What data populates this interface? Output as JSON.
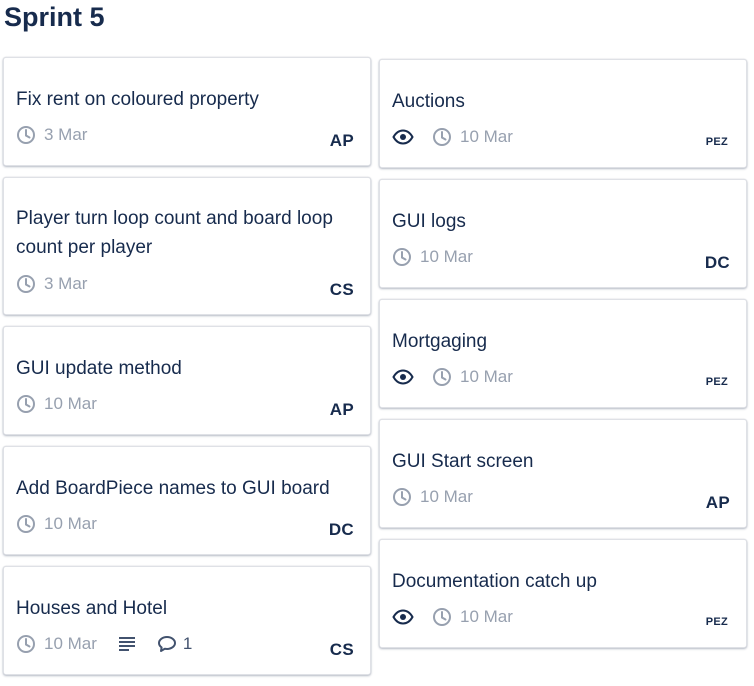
{
  "list": {
    "title": "Sprint 5"
  },
  "cards": {
    "left": [
      {
        "title": "Fix rent on coloured property",
        "due": "3 Mar",
        "member": "AP"
      },
      {
        "title": "Player turn loop count and board loop count per player",
        "due": "3 Mar",
        "member": "CS"
      },
      {
        "title": "GUI update method",
        "due": "10 Mar",
        "member": "AP"
      },
      {
        "title": "Add BoardPiece names to GUI board",
        "due": "10 Mar",
        "member": "DC"
      },
      {
        "title": "Houses and Hotel",
        "due": "10 Mar",
        "comments": "1",
        "member": "CS"
      }
    ],
    "right": [
      {
        "title": "Auctions",
        "due": "10 Mar",
        "member": "PEZ"
      },
      {
        "title": "GUI logs",
        "due": "10 Mar",
        "member": "DC"
      },
      {
        "title": "Mortgaging",
        "due": "10 Mar",
        "member": "PEZ"
      },
      {
        "title": "GUI Start screen",
        "due": "10 Mar",
        "member": "AP"
      },
      {
        "title": "Documentation catch up",
        "due": "10 Mar",
        "member": "PEZ"
      }
    ]
  },
  "icons": {
    "due": "clock-icon",
    "watch": "eye-icon",
    "description": "description-lines-icon",
    "comments": "comment-bubble-icon"
  }
}
